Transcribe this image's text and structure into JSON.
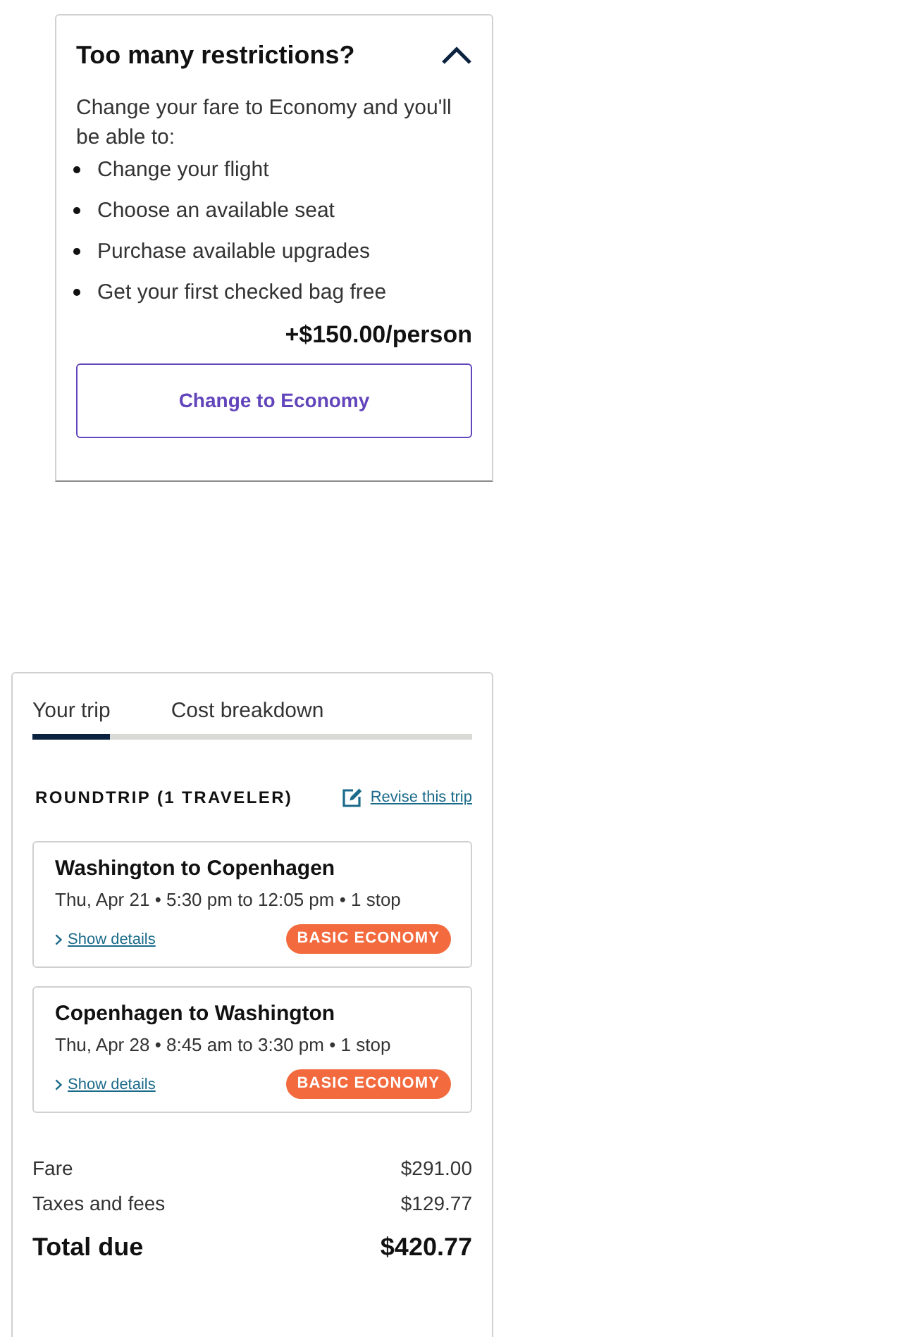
{
  "upsell": {
    "title": "Too many restrictions?",
    "expanded": true,
    "intro": "Change your fare to Economy and you'll be able to:",
    "benefits": [
      "Change your flight",
      "Choose an available seat",
      "Purchase available upgrades",
      "Get your first checked bag free"
    ],
    "price": "+$150.00/person",
    "button": "Change to Economy"
  },
  "trip_summary": {
    "tabs": [
      {
        "label": "Your trip",
        "selected": true
      },
      {
        "label": "Cost breakdown",
        "selected": false
      }
    ],
    "heading": "ROUNDTRIP (1 TRAVELER)",
    "revise_link": "Revise this trip",
    "flights": [
      {
        "route": "Washington to Copenhagen",
        "details": "Thu, Apr 21 • 5:30 pm to 12:05 pm • 1 stop",
        "details_link": "Show details",
        "fare_badge": "BASIC ECONOMY"
      },
      {
        "route": "Copenhagen to Washington",
        "details": "Thu, Apr 28 • 8:45 am to 3:30 pm • 1 stop",
        "details_link": "Show details",
        "fare_badge": "BASIC ECONOMY"
      }
    ],
    "costs": [
      {
        "kind": "line",
        "label": "Fare",
        "amount": "$291.00"
      },
      {
        "kind": "line",
        "label": "Taxes and fees",
        "amount": "$129.77"
      },
      {
        "kind": "total",
        "label": "Total due",
        "amount": "$420.77"
      }
    ]
  }
}
